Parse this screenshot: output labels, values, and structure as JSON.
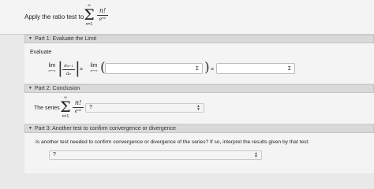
{
  "problem": {
    "intro": "Apply the ratio test to",
    "sum_top": "∞",
    "sum_bottom": "n=1",
    "numerator": "n!",
    "denominator": "eⁿ²"
  },
  "part1": {
    "header": "Part 1: Evaluate the Limit",
    "evaluate": "Evaluate",
    "lim_word": "lim",
    "lim_sub": "n→∞",
    "ratio_num": "aₙ₊₁",
    "ratio_den": "aₙ",
    "equals": "=",
    "input1_value": "",
    "input2_value": "",
    "sigma_label": "Σ"
  },
  "part2": {
    "header": "Part 2: Conclusion",
    "series_text": "The series",
    "select_value": "?"
  },
  "part3": {
    "header": "Part 3: Another test to confirm convergence or divergence",
    "question": "Is another test needed to confirm convergence or divergence of the series? If so, interpret the results given by that test:",
    "select_value": "?"
  },
  "icons": {
    "caret": "caret-down-icon",
    "sigma": "sigma-icon",
    "select_arrows": "chevron-updown-icon"
  }
}
